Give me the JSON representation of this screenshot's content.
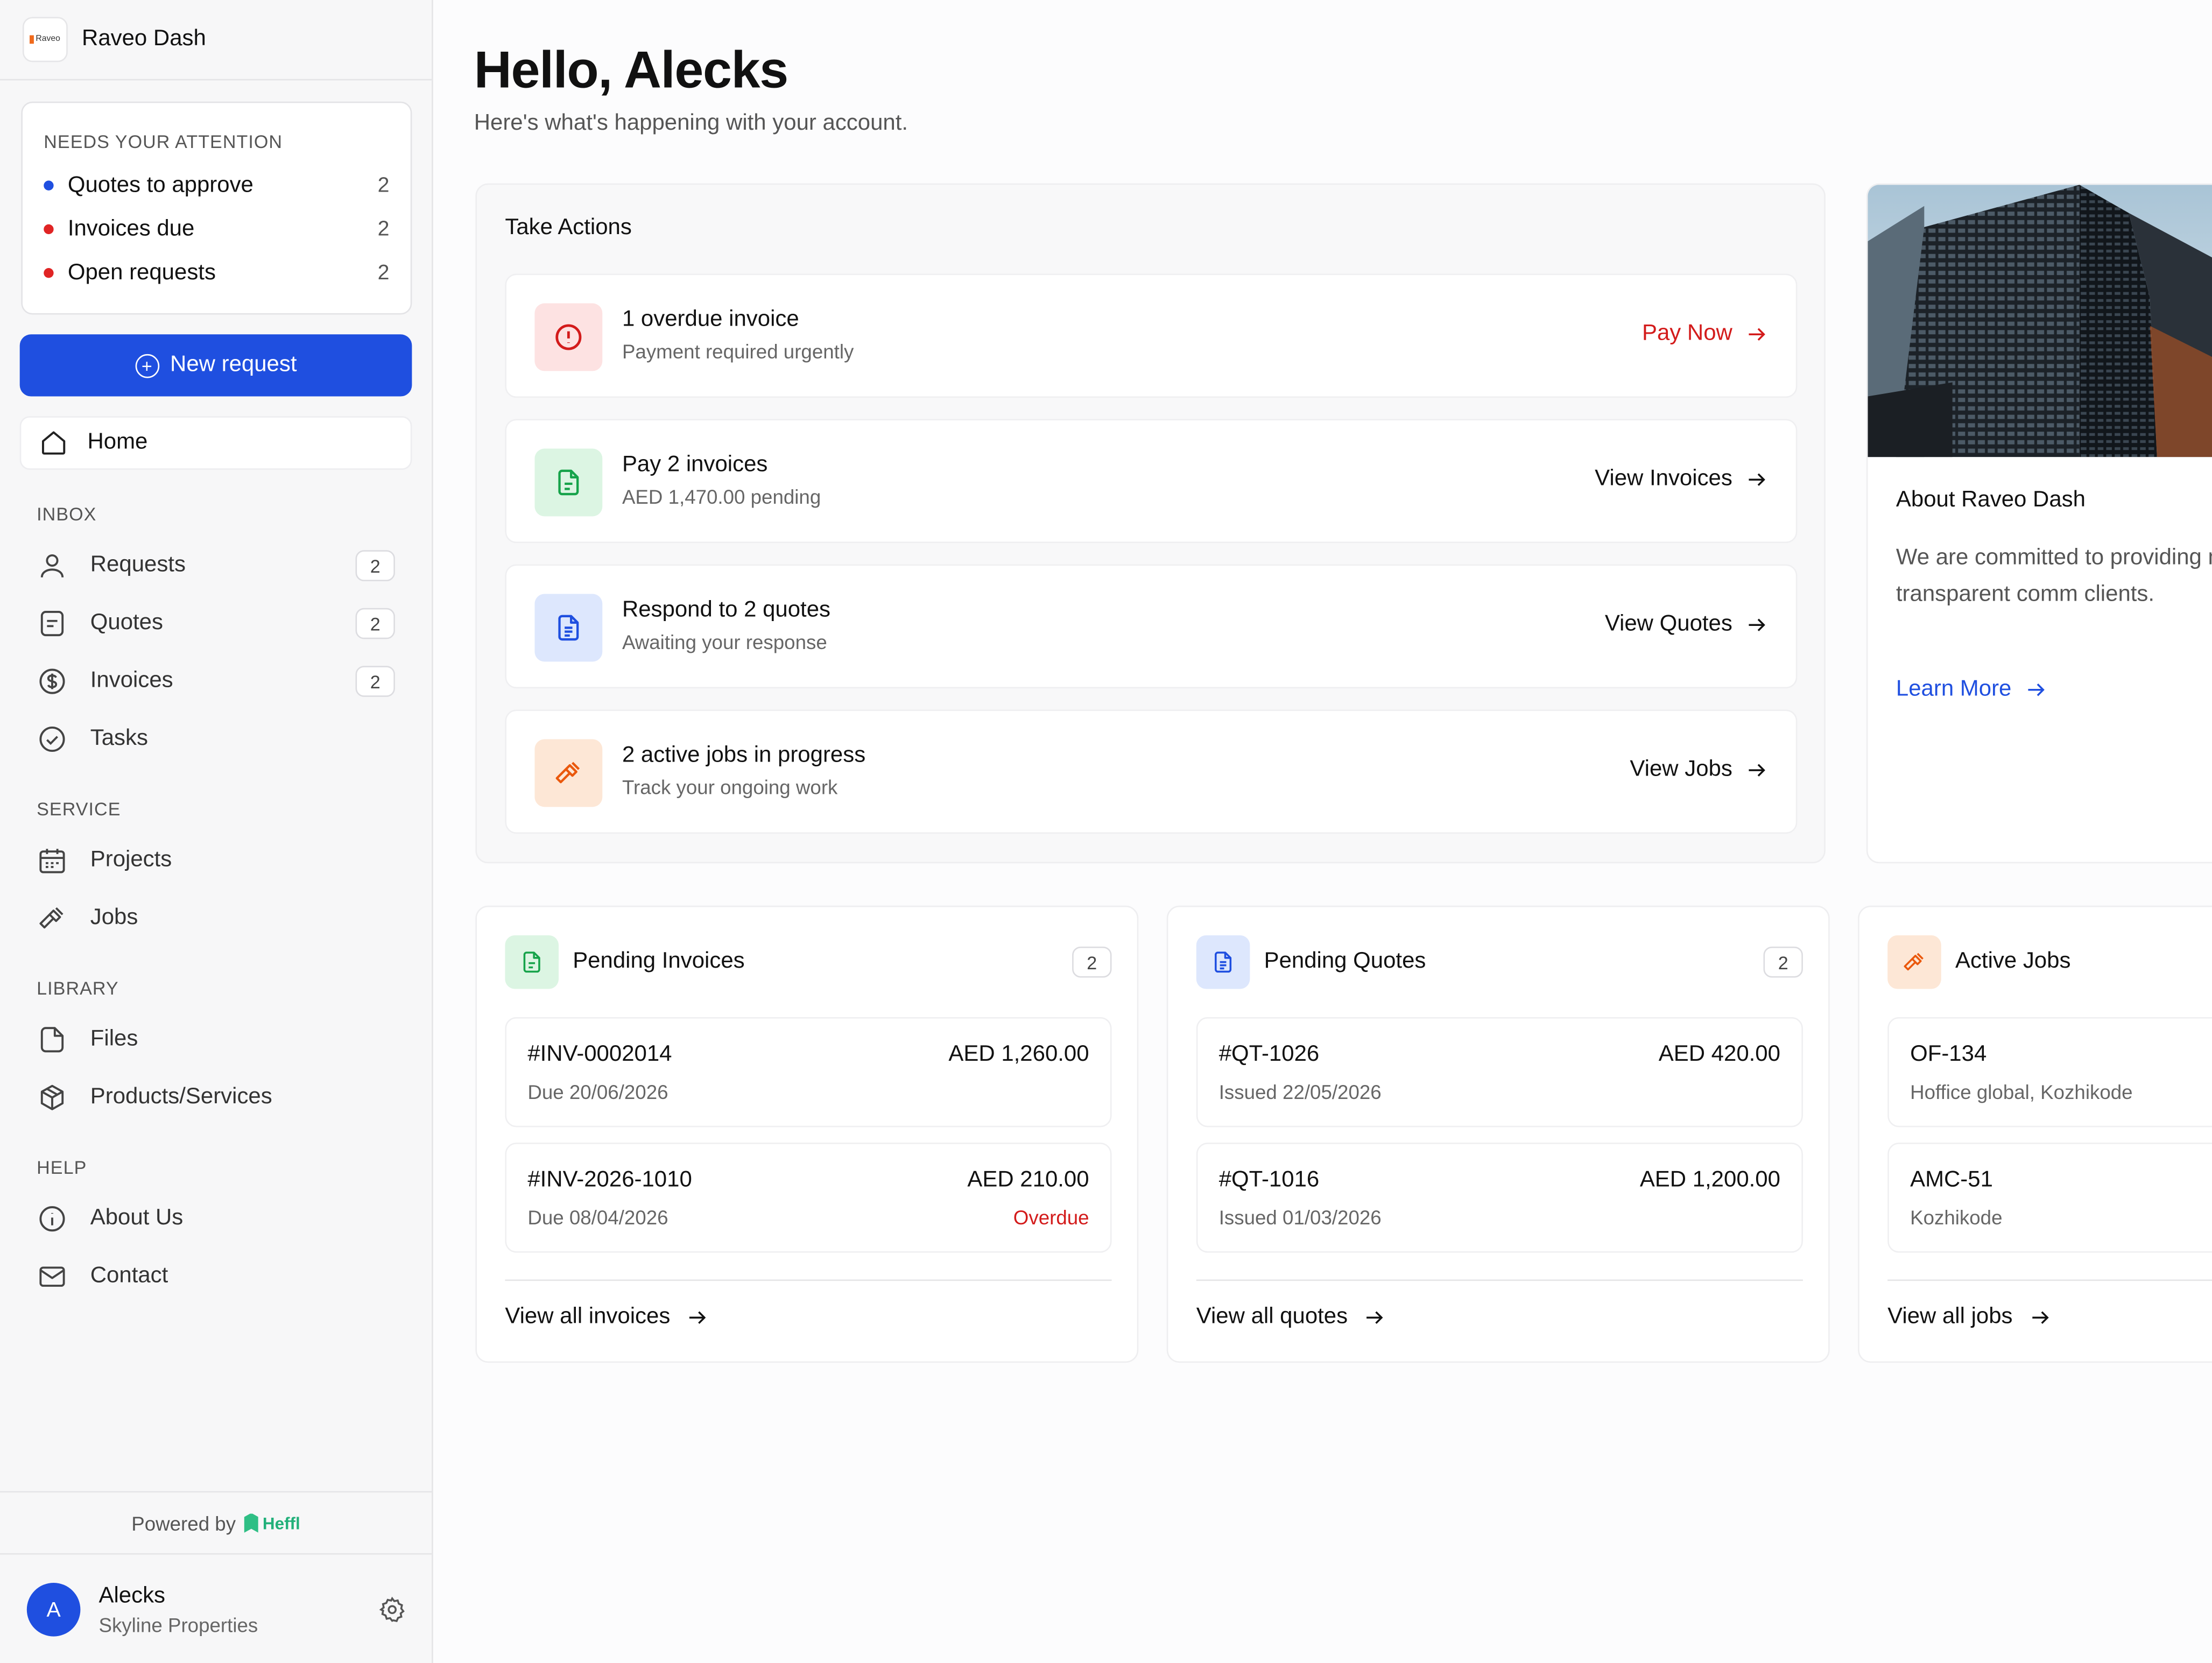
{
  "app": {
    "name": "Raveo Dash",
    "logo_text": "Raveo"
  },
  "attention": {
    "title": "NEEDS YOUR ATTENTION",
    "items": [
      {
        "label": "Quotes to approve",
        "count": "2",
        "color": "#1f4fe0"
      },
      {
        "label": "Invoices due",
        "count": "2",
        "color": "#e02424"
      },
      {
        "label": "Open requests",
        "count": "2",
        "color": "#e02424"
      }
    ]
  },
  "new_request": {
    "label": "New request"
  },
  "nav": {
    "home": "Home",
    "sections": {
      "inbox": "INBOX",
      "service": "SERVICE",
      "library": "LIBRARY",
      "help": "HELP"
    },
    "items": {
      "requests": {
        "label": "Requests",
        "badge": "2"
      },
      "quotes": {
        "label": "Quotes",
        "badge": "2"
      },
      "invoices": {
        "label": "Invoices",
        "badge": "2"
      },
      "tasks": {
        "label": "Tasks"
      },
      "projects": {
        "label": "Projects"
      },
      "jobs": {
        "label": "Jobs"
      },
      "files": {
        "label": "Files"
      },
      "products": {
        "label": "Products/Services"
      },
      "about": {
        "label": "About Us"
      },
      "contact": {
        "label": "Contact"
      }
    }
  },
  "footer": {
    "powered_by": "Powered by",
    "vendor": "Heffl"
  },
  "user": {
    "initial": "A",
    "name": "Alecks",
    "org": "Skyline Properties"
  },
  "main": {
    "greeting": "Hello, Alecks",
    "subtitle": "Here's what's happening with your account."
  },
  "take_actions": {
    "title": "Take Actions",
    "rows": [
      {
        "title": "1 overdue invoice",
        "subtitle": "Payment required urgently",
        "link": "Pay Now",
        "icon": "alert-circle-icon",
        "accent": "#d31b1b"
      },
      {
        "title": "Pay 2 invoices",
        "subtitle": "AED 1,470.00 pending",
        "link": "View Invoices",
        "icon": "invoice-doc-icon",
        "accent": "#16a34a"
      },
      {
        "title": "Respond to 2 quotes",
        "subtitle": "Awaiting your response",
        "link": "View Quotes",
        "icon": "quote-doc-icon",
        "accent": "#1f4fe0"
      },
      {
        "title": "2 active jobs in progress",
        "subtitle": "Track your ongoing work",
        "link": "View Jobs",
        "icon": "hammer-icon",
        "accent": "#ea580c"
      }
    ]
  },
  "about": {
    "title": "About Raveo Dash",
    "text": "We are committed to providing maintaining transparent comm clients.",
    "link": "Learn More"
  },
  "panels": {
    "invoices": {
      "title": "Pending Invoices",
      "badge": "2",
      "link": "View all invoices",
      "items": [
        {
          "id": "#INV-0002014",
          "meta": "Due 20/06/2026",
          "amount": "AED 1,260.00",
          "status": ""
        },
        {
          "id": "#INV-2026-1010",
          "meta": "Due 08/04/2026",
          "amount": "AED 210.00",
          "status": "Overdue"
        }
      ]
    },
    "quotes": {
      "title": "Pending Quotes",
      "badge": "2",
      "link": "View all quotes",
      "items": [
        {
          "id": "#QT-1026",
          "meta": "Issued 22/05/2026",
          "amount": "AED 420.00"
        },
        {
          "id": "#QT-1016",
          "meta": "Issued 01/03/2026",
          "amount": "AED 1,200.00"
        }
      ]
    },
    "jobs": {
      "title": "Active Jobs",
      "link": "View all jobs",
      "items": [
        {
          "id": "OF-134",
          "meta": "Hoffice global, Kozhikode"
        },
        {
          "id": "AMC-51",
          "meta": "Kozhikode"
        }
      ]
    }
  }
}
